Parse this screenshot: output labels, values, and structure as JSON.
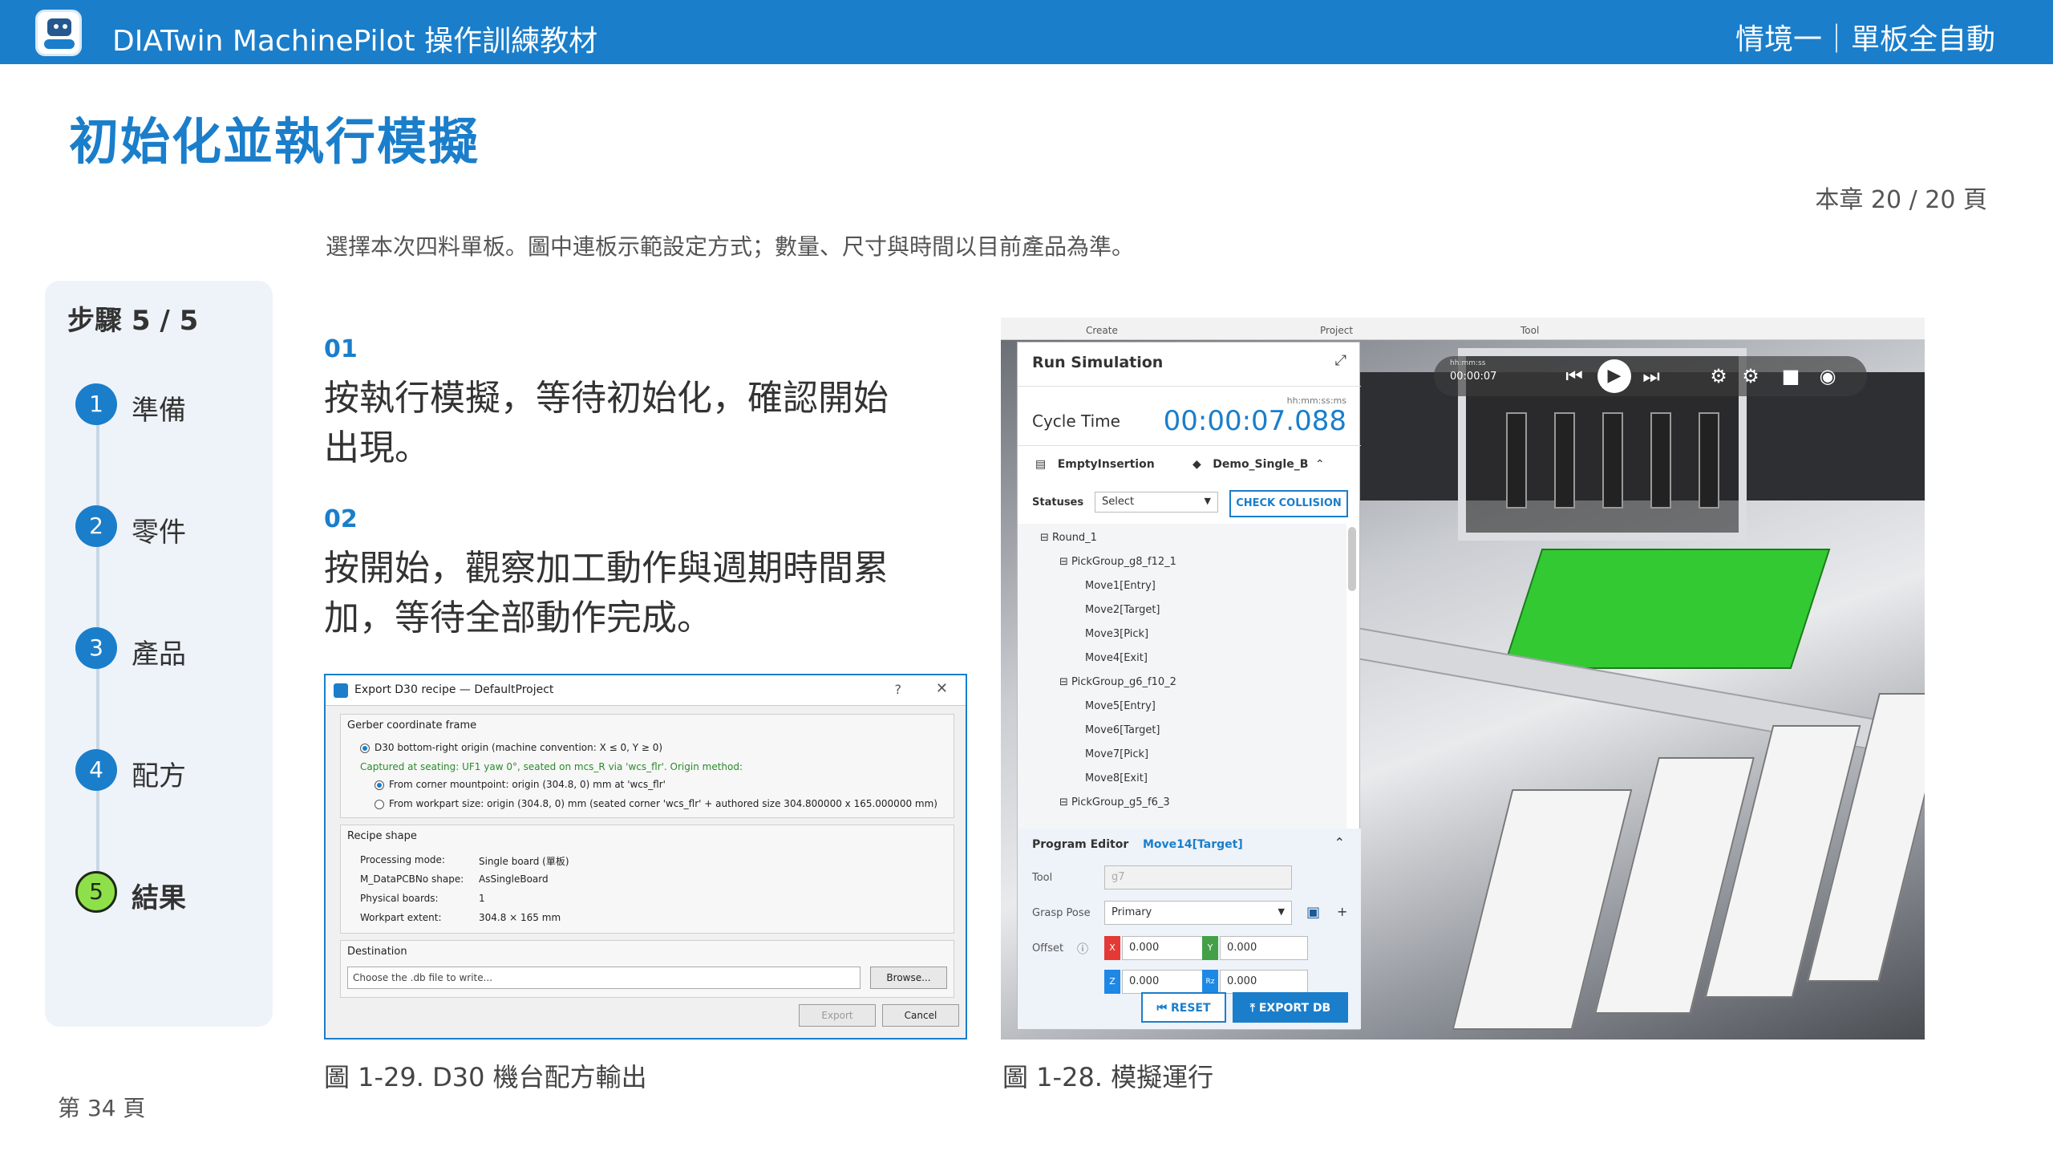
{
  "header": {
    "app_title": "DIATwin MachinePilot 操作訓練教材",
    "scenario": "情境一｜單板全自動"
  },
  "page": {
    "title": "初始化並執行模擬",
    "chapter_page": "本章 20 / 20 頁",
    "intro": "選擇本次四料單板。圖中連板示範設定方式；數量、尺寸與時間以目前產品為準。",
    "footer_page": "第 34 頁"
  },
  "steps": {
    "title": "步驟 5 / 5",
    "items": [
      {
        "num": "1",
        "label": "準備"
      },
      {
        "num": "2",
        "label": "零件"
      },
      {
        "num": "3",
        "label": "產品"
      },
      {
        "num": "4",
        "label": "配方"
      },
      {
        "num": "5",
        "label": "結果"
      }
    ]
  },
  "instructions": [
    {
      "num": "01",
      "text": "按執行模擬，等待初始化，確認開始出現。"
    },
    {
      "num": "02",
      "text": "按開始，觀察加工動作與週期時間累加，等待全部動作完成。"
    }
  ],
  "captions": {
    "left": "圖 1-29. D30 機台配方輸出",
    "right": "圖 1-28. 模擬運行"
  },
  "export_dialog": {
    "title": "Export D30 recipe — DefaultProject",
    "help": "?",
    "close": "✕",
    "gerber_group": "Gerber coordinate frame",
    "opt_bottom_right": "D30 bottom-right origin (machine convention: X ≤ 0, Y ≥ 0)",
    "captured": "Captured at seating: UF1 yaw 0°, seated on mcs_R via 'wcs_flr'. Origin method:",
    "opt_corner": "From corner mountpoint: origin (304.8, 0) mm at 'wcs_flr'",
    "opt_workpart": "From workpart size: origin (304.8, 0) mm (seated corner 'wcs_flr' + authored size 304.800000 x 165.000000 mm)",
    "recipe_group": "Recipe shape",
    "recipe_rows": [
      {
        "key": "Processing mode:",
        "value": "Single board (單板)"
      },
      {
        "key": "M_DataPCBNo shape:",
        "value": "AsSingleBoard"
      },
      {
        "key": "Physical boards:",
        "value": "1"
      },
      {
        "key": "Workpart extent:",
        "value": "304.8 × 165 mm"
      }
    ],
    "destination_group": "Destination",
    "destination_placeholder": "Choose the .db file to write...",
    "browse": "Browse...",
    "export": "Export",
    "cancel": "Cancel"
  },
  "simulation": {
    "ribbon": [
      "Create",
      "Project",
      "Tool"
    ],
    "player": {
      "time_label": "hh:mm:ss",
      "time": "00:00:07"
    },
    "panel_title": "Run Simulation",
    "cycle_unit": "hh:mm:ss:ms",
    "cycle_label": "Cycle Time",
    "cycle_value": "00:00:07.088",
    "insertion": "EmptyInsertion",
    "board": "Demo_Single_B",
    "statuses_label": "Statuses",
    "statuses_value": "Select",
    "check_collision": "CHECK COLLISION",
    "tree": [
      {
        "text": "Round_1",
        "level": 0,
        "toggle": "⊟"
      },
      {
        "text": "PickGroup_g8_f12_1",
        "level": 1,
        "toggle": "⊟"
      },
      {
        "text": "Move1[Entry]",
        "level": 2,
        "toggle": ""
      },
      {
        "text": "Move2[Target]",
        "level": 2,
        "toggle": ""
      },
      {
        "text": "Move3[Pick]",
        "level": 2,
        "toggle": ""
      },
      {
        "text": "Move4[Exit]",
        "level": 2,
        "toggle": ""
      },
      {
        "text": "PickGroup_g6_f10_2",
        "level": 1,
        "toggle": "⊟"
      },
      {
        "text": "Move5[Entry]",
        "level": 2,
        "toggle": ""
      },
      {
        "text": "Move6[Target]",
        "level": 2,
        "toggle": ""
      },
      {
        "text": "Move7[Pick]",
        "level": 2,
        "toggle": ""
      },
      {
        "text": "Move8[Exit]",
        "level": 2,
        "toggle": ""
      },
      {
        "text": "PickGroup_g5_f6_3",
        "level": 1,
        "toggle": "⊟"
      }
    ],
    "program_editor": {
      "title": "Program Editor",
      "target": "Move14[Target]",
      "tool_label": "Tool",
      "tool_value": "g7",
      "grasp_label": "Grasp Pose",
      "grasp_value": "Primary",
      "offset_label": "Offset",
      "x": "0.000",
      "y": "0.000",
      "z": "0.000",
      "rz": "0.000",
      "reset": "RESET",
      "export_db": "EXPORT DB"
    }
  },
  "colors": {
    "brand": "#1a7ecb",
    "active_step": "#8ee04a",
    "pcb_green": "#33c933"
  }
}
